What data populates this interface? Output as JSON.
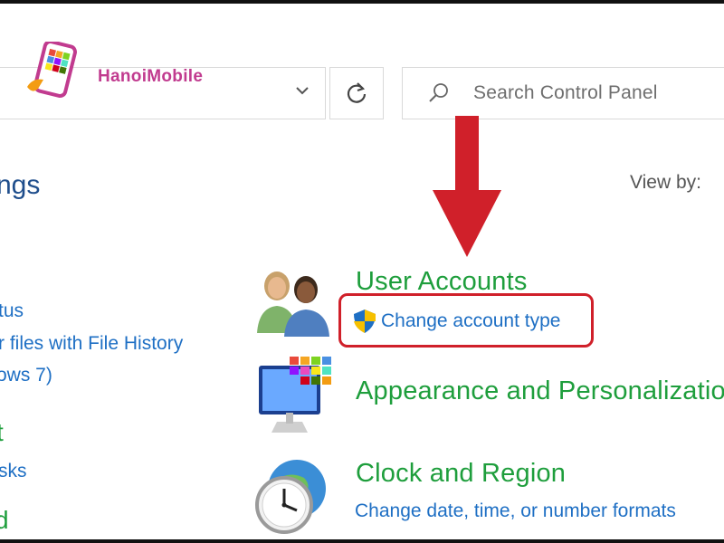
{
  "logo": {
    "text": "HanoiMobile"
  },
  "search": {
    "placeholder": "Search Control Panel"
  },
  "header": {
    "heading_partial": "ngs",
    "view_by_label": "View by:"
  },
  "left_items": [
    {
      "text": "tus"
    },
    {
      "text": "r files with File History"
    },
    {
      "text": "ows 7)"
    },
    {
      "text": "t"
    },
    {
      "text": "sks"
    },
    {
      "text": "d"
    }
  ],
  "categories": [
    {
      "title": "User Accounts",
      "link": "Change account type",
      "icon": "users-icon"
    },
    {
      "title": "Appearance and Personalizatio",
      "icon": "monitor-icon"
    },
    {
      "title": "Clock and Region",
      "link": "Change date, time, or number formats",
      "icon": "clock-globe-icon"
    }
  ],
  "colors": {
    "category_title": "#1e9e3c",
    "link": "#1e6fc4",
    "annotation_red": "#d0202a"
  }
}
